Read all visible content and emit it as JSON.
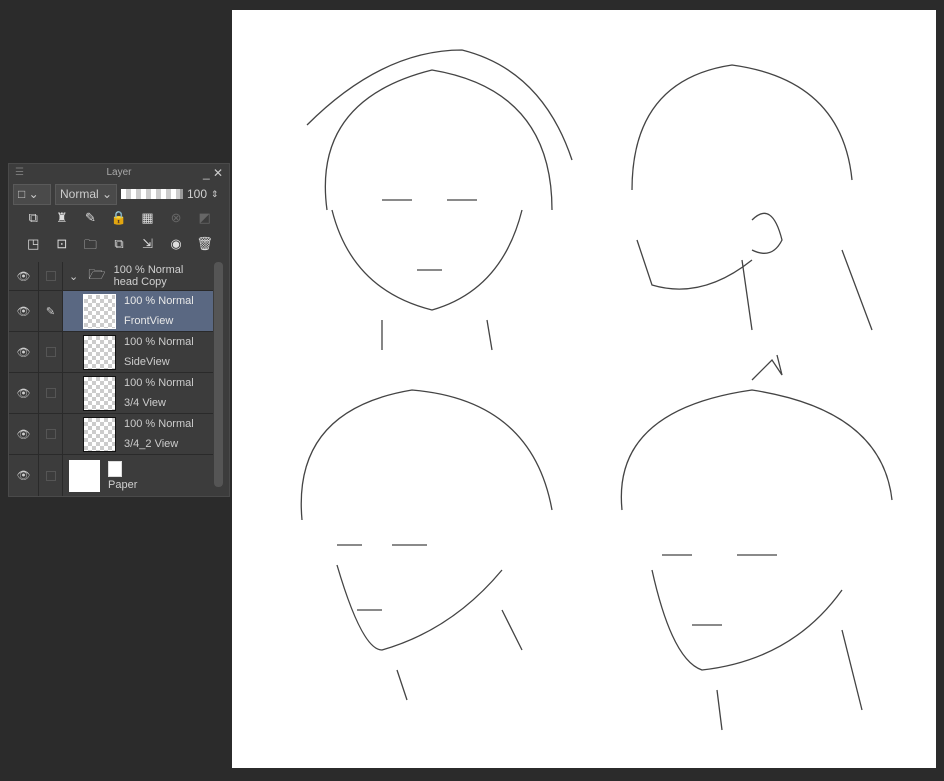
{
  "panel": {
    "title": "Layer",
    "blend_mode": "Normal",
    "opacity": "100"
  },
  "layers": [
    {
      "name": "head Copy",
      "meta": "100 % Normal",
      "type": "folder"
    },
    {
      "name": "FrontView",
      "meta": "100 % Normal",
      "selected": true
    },
    {
      "name": "SideView",
      "meta": "100 % Normal"
    },
    {
      "name": "3/4 View",
      "meta": "100 % Normal"
    },
    {
      "name": "3/4_2 View",
      "meta": "100 % Normal"
    },
    {
      "name": "Paper",
      "type": "paper"
    }
  ]
}
